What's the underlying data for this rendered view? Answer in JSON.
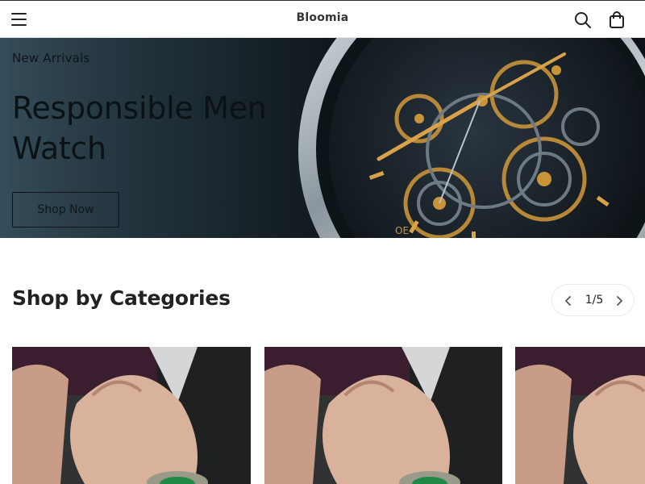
{
  "header": {
    "brand": "Bloomia",
    "icons": [
      "menu-icon",
      "search-icon",
      "shopping-bag-icon"
    ]
  },
  "hero": {
    "eyebrow": "New Arrivals",
    "title": "Responsible Men Watch",
    "button_label": "Shop Now",
    "watch_bezel_text": "OE"
  },
  "categories": {
    "title": "Shop by Categories",
    "pager": "1/5",
    "cards": [
      {
        "image": "wrist-watch-photo"
      },
      {
        "image": "wrist-watch-photo"
      },
      {
        "image": "wrist-watch-photo"
      }
    ]
  },
  "colors": {
    "accent_gold": "#c9933a",
    "hero_dark": "#0a0f13",
    "watch_green": "#1f8a46"
  }
}
